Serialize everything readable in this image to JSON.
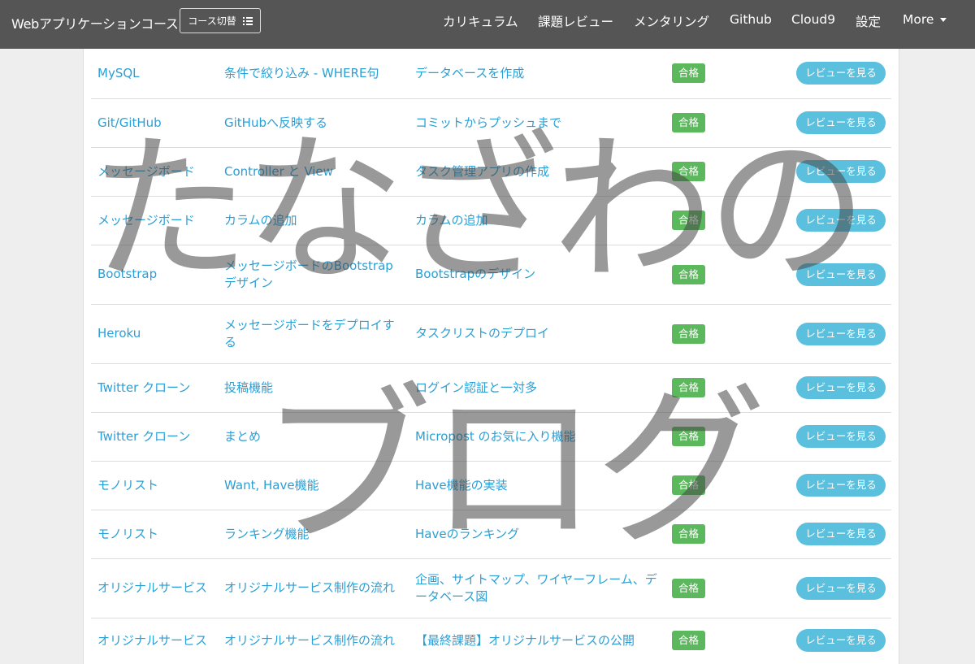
{
  "navbar": {
    "brand": "Webアプリケーションコース",
    "course_switch": "コース切替",
    "items": [
      "カリキュラム",
      "課題レビュー",
      "メンタリング",
      "Github",
      "Cloud9",
      "設定"
    ],
    "more": "More"
  },
  "rows": [
    {
      "course": "MySQL",
      "lesson": "条件で絞り込み - WHERE句",
      "task": "データベースを作成",
      "status": "合格",
      "action": "レビューを見る"
    },
    {
      "course": "Git/GitHub",
      "lesson": "GitHubへ反映する",
      "task": "コミットからプッシュまで",
      "status": "合格",
      "action": "レビューを見る"
    },
    {
      "course": "メッセージボード",
      "lesson": "Controller と View",
      "task": "タスク管理アプリの作成",
      "status": "合格",
      "action": "レビューを見る"
    },
    {
      "course": "メッセージボード",
      "lesson": "カラムの追加",
      "task": "カラムの追加",
      "status": "合格",
      "action": "レビューを見る"
    },
    {
      "course": "Bootstrap",
      "lesson": "メッセージボードのBootstrapデザイン",
      "task": "Bootstrapのデザイン",
      "status": "合格",
      "action": "レビューを見る"
    },
    {
      "course": "Heroku",
      "lesson": "メッセージボードをデプロイする",
      "task": "タスクリストのデプロイ",
      "status": "合格",
      "action": "レビューを見る"
    },
    {
      "course": "Twitter クローン",
      "lesson": "投稿機能",
      "task": "ログイン認証と一対多",
      "status": "合格",
      "action": "レビューを見る"
    },
    {
      "course": "Twitter クローン",
      "lesson": "まとめ",
      "task": "Micropost のお気に入り機能",
      "status": "合格",
      "action": "レビューを見る"
    },
    {
      "course": "モノリスト",
      "lesson": "Want, Have機能",
      "task": "Have機能の実装",
      "status": "合格",
      "action": "レビューを見る"
    },
    {
      "course": "モノリスト",
      "lesson": "ランキング機能",
      "task": "Haveのランキング",
      "status": "合格",
      "action": "レビューを見る"
    },
    {
      "course": "オリジナルサービス",
      "lesson": "オリジナルサービス制作の流れ",
      "task": "企画、サイトマップ、ワイヤーフレーム、データベース図",
      "status": "合格",
      "action": "レビューを見る"
    },
    {
      "course": "オリジナルサービス",
      "lesson": "オリジナルサービス制作の流れ",
      "task": "【最終課題】オリジナルサービスの公開",
      "status": "合格",
      "action": "レビューを見る"
    }
  ],
  "watermark": {
    "line1": "たなざわの",
    "line2": "ブログ"
  },
  "colors": {
    "navbar": "#555555",
    "link": "#2a9fd6",
    "badge_success": "#5cb85c",
    "button_info": "#5bc0de",
    "background": "#eeeeee"
  }
}
